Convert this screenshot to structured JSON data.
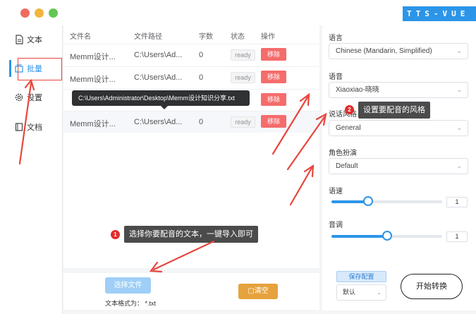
{
  "window": {
    "brand": "TTS-VUE"
  },
  "sidebar": {
    "items": [
      {
        "label": "文本",
        "icon": "document-icon"
      },
      {
        "label": "批量",
        "icon": "batch-icon"
      },
      {
        "label": "设置",
        "icon": "gear-icon"
      },
      {
        "label": "文档",
        "icon": "book-icon"
      }
    ],
    "active": "批量"
  },
  "table": {
    "headers": [
      "文件名",
      "文件路径",
      "字数",
      "状态",
      "操作"
    ],
    "rows": [
      {
        "name": "Memm设计...",
        "path": "C:\\Users\\Ad...",
        "count": "0",
        "status": "ready",
        "action": "移除"
      },
      {
        "name": "Memm设计...",
        "path": "C:\\Users\\Ad...",
        "count": "0",
        "status": "ready",
        "action": "移除"
      },
      {
        "name": "",
        "path": "",
        "count": "",
        "status": "",
        "action": "移除"
      },
      {
        "name": "Memm设计...",
        "path": "C:\\Users\\Ad...",
        "count": "0",
        "status": "ready",
        "action": "移除"
      }
    ],
    "tooltip": "C:\\Users\\Administrator\\Desktop\\Memm设计知识分享.txt"
  },
  "bottom": {
    "choose_label": "选择文件",
    "format_text": "文本格式为：  *.txt",
    "clear_label": "清空"
  },
  "settings": {
    "language_label": "语言",
    "language_value": "Chinese (Mandarin, Simplified)",
    "voice_label": "语音",
    "voice_value": "Xiaoxiao-晓晓",
    "style_label": "说话风格",
    "style_value": "General",
    "role_label": "角色扮演",
    "role_value": "Default",
    "rate_label": "语速",
    "rate_value": "1",
    "rate_fraction": 0.33,
    "pitch_label": "音调",
    "pitch_value": "1",
    "pitch_fraction": 0.5,
    "save_label": "保存配置",
    "preset_value": "默认",
    "start_label": "开始转换"
  },
  "annotations": {
    "callout1_num": "1",
    "callout1_text": "选择你要配音的文本，一键导入即可",
    "callout2_num": "2",
    "callout2_text": "设置要配音的风格"
  },
  "colors": {
    "accent": "#2c95e8",
    "danger": "#f56c6c",
    "warning": "#e6a23c",
    "annotation_red": "#e42b2b"
  }
}
